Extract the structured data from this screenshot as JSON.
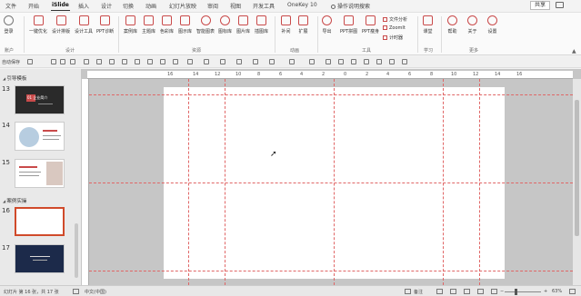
{
  "menubar": {
    "tabs": [
      "文件",
      "开始",
      "iSlide",
      "插入",
      "设计",
      "切换",
      "动画",
      "幻灯片放映",
      "审阅",
      "视图",
      "开发工具",
      "OneKey 10"
    ],
    "active_tab": "iSlide",
    "tell_me": "操作说明搜索",
    "share": "共享"
  },
  "ribbon": {
    "groups": {
      "account": "账户",
      "design": "设计",
      "resources": "资源",
      "animation": "动画",
      "tools": "工具",
      "learn": "学习",
      "more": "更多"
    },
    "buttons": {
      "login": "登录",
      "one_click_optimize": "一键优化",
      "design_layout": "设计排版",
      "design_tools": "设计工具",
      "ppt_diagnose": "PPT诊断",
      "case_library": "案例库",
      "theme_library": "主题库",
      "color_library": "色彩库",
      "icon_library": "图示库",
      "smart_chart": "智能图表",
      "icon_lib2": "图标库",
      "image_library": "图片库",
      "illustration_library": "插图库",
      "tween": "补间",
      "extend": "扩展",
      "export": "导出",
      "ppt_puzzle": "PPT拼图",
      "ppt_slim": "PPT瘦身",
      "file_analysis": "文件分析",
      "zoomit": "ZoomIt",
      "timer": "计时器",
      "classroom": "课堂",
      "help": "帮助",
      "about": "关于",
      "settings": "设置"
    }
  },
  "qat": {
    "autosave": "自动保存"
  },
  "panel": {
    "sections": [
      "引导模板",
      "案例实操"
    ],
    "slides": [
      {
        "num": "13",
        "style": "dark",
        "caption": "01 企业简介"
      },
      {
        "num": "14",
        "style": "light",
        "caption": ""
      },
      {
        "num": "15",
        "style": "light",
        "caption": ""
      },
      {
        "num": "16",
        "style": "selected",
        "caption": ""
      },
      {
        "num": "17",
        "style": "navy",
        "caption": ""
      }
    ]
  },
  "ruler": {
    "top": [
      "16",
      "14",
      "12",
      "10",
      "8",
      "6",
      "4",
      "2",
      "0",
      "2",
      "4",
      "6",
      "8",
      "10",
      "12",
      "14",
      "16"
    ]
  },
  "status": {
    "slide_info": "幻灯片 第 16 张，共 17 张",
    "language": "中文(中国)",
    "notes": "备注",
    "zoom": "63%",
    "zoom_level": 0.63
  }
}
